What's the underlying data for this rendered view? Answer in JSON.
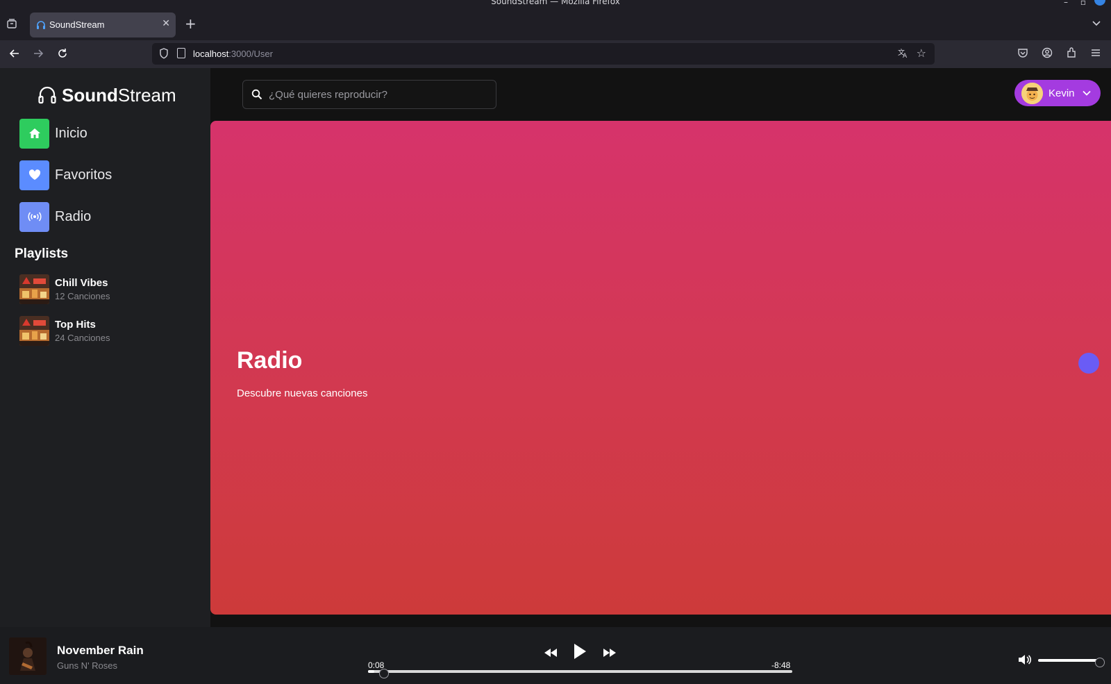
{
  "browser": {
    "window_title": "SoundStream — Mozilla Firefox",
    "tab_title": "SoundStream",
    "url_host": "localhost",
    "url_path": ":3000/User"
  },
  "app": {
    "logo_bold": "Sound",
    "logo_light": "Stream",
    "nav": [
      {
        "label": "Inicio",
        "color": "#2ecc5e"
      },
      {
        "label": "Favoritos",
        "color": "#5b8cff"
      },
      {
        "label": "Radio",
        "color": "#6f8df5"
      }
    ],
    "playlists_title": "Playlists",
    "playlists": [
      {
        "name": "Chill Vibes",
        "count": "12 Canciones"
      },
      {
        "name": "Top Hits",
        "count": "24 Canciones"
      }
    ],
    "search_placeholder": "¿Qué quieres reproducir?",
    "user_name": "Kevin",
    "hero": {
      "title": "Radio",
      "subtitle": "Descubre nuevas canciones"
    }
  },
  "player": {
    "title": "November Rain",
    "artist": "Guns N' Roses",
    "elapsed": "0:08",
    "remaining": "-8:48",
    "progress": 0.015,
    "volume": 1.0
  }
}
